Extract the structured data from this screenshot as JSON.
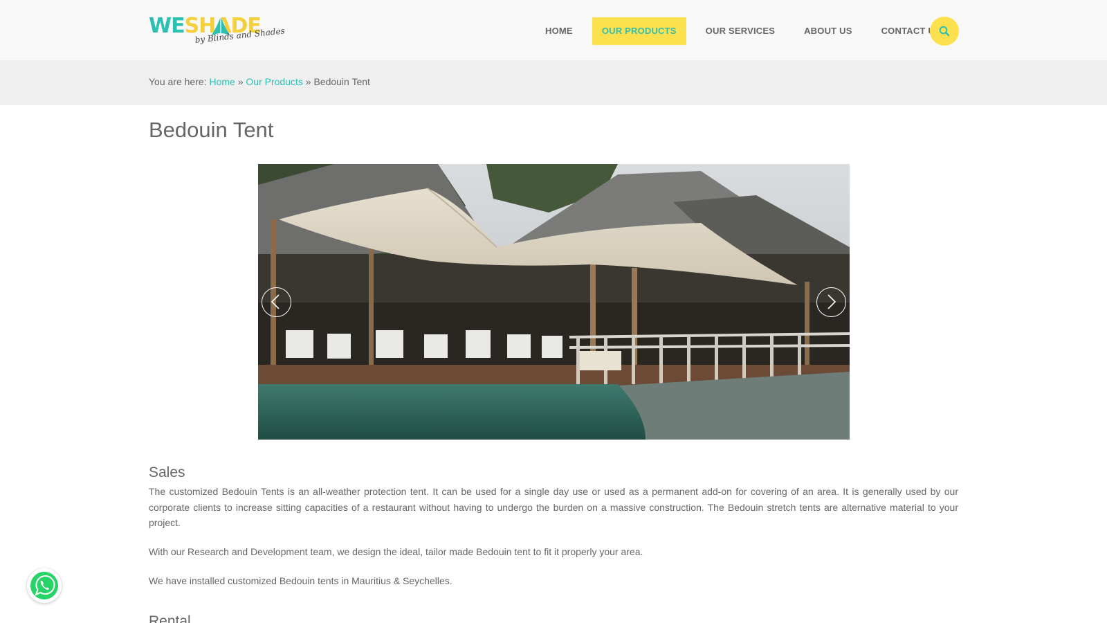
{
  "header": {
    "logo": {
      "part1": "WE",
      "part2": "SHADE",
      "tagline": "by Blinds and Shades"
    },
    "nav": [
      {
        "label": "HOME",
        "active": false
      },
      {
        "label": "OUR PRODUCTS",
        "active": true
      },
      {
        "label": "OUR SERVICES",
        "active": false
      },
      {
        "label": "ABOUT US",
        "active": false
      },
      {
        "label": "CONTACT US",
        "active": false
      }
    ],
    "search_icon": "search-icon"
  },
  "breadcrumb": {
    "prefix": "You are here:",
    "items": [
      "Home",
      "Our Products",
      "Bedouin Tent"
    ],
    "separator": "»"
  },
  "page": {
    "title": "Bedouin Tent"
  },
  "slider": {
    "prev_icon": "chevron-left-icon",
    "next_icon": "chevron-right-icon"
  },
  "content": {
    "sales_heading": "Sales",
    "sales_p1": "The customized Bedouin Tents is an all-weather protection tent. It can be used for a single day use or used as a permanent add-on for covering of an area. It is generally used by our corporate clients to increase sitting capacities of a restaurant without having to undergo the burden on a massive construction. The Bedouin stretch tents are alternative material to your project.",
    "sales_p2": "With our Research and Development team, we design the ideal, tailor made Bedouin tent to fit it properly your area.",
    "sales_p3": "We have installed customized Bedouin tents in Mauritius & Seychelles.",
    "rental_heading": "Rental"
  },
  "whatsapp_icon": "whatsapp-icon",
  "colors": {
    "accent_teal": "#2ebfb3",
    "accent_yellow": "#fde04e",
    "header_bg": "#f8f8f8",
    "band_bg": "#efefef",
    "text": "#666666"
  }
}
